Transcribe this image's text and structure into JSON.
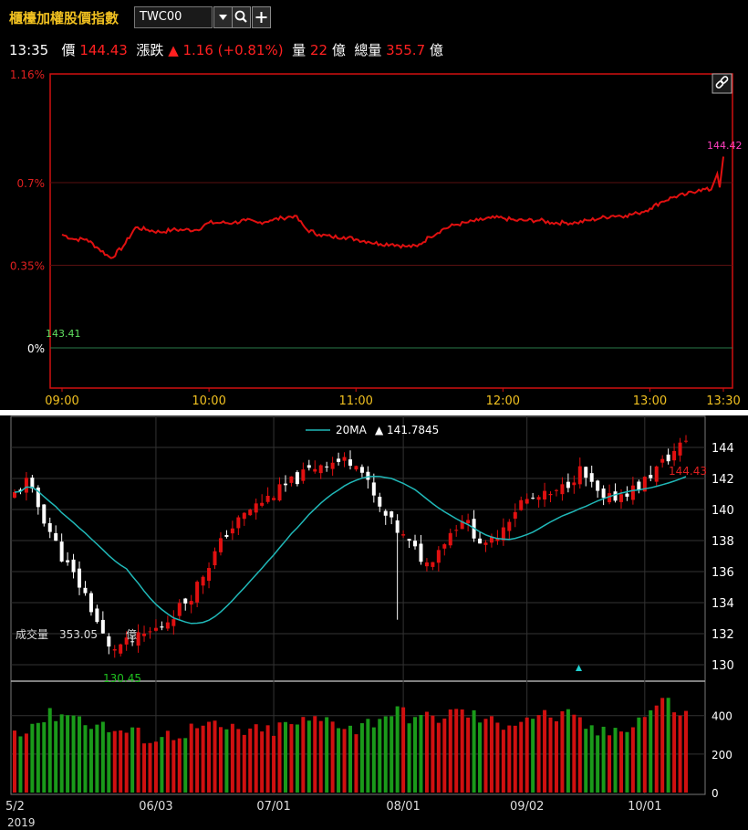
{
  "header": {
    "title": "櫃檯加權股價指數",
    "symbol": "TWC00",
    "time": "13:35",
    "price_label": "價",
    "price": "144.43",
    "change_label": "漲跌",
    "change": "▲ 1.16 (+0.81%)",
    "volume_label": "量",
    "volume": "22",
    "volume_unit": "億",
    "total_volume_label": "總量",
    "total_volume": "355.7",
    "total_volume_unit": "億"
  },
  "icons": {
    "dropdown": "chevron-down-icon",
    "search": "search-icon",
    "add": "plus-icon",
    "link": "link-icon"
  },
  "colors": {
    "up": "#ff2020",
    "down": "#20a020",
    "ma": "#20b8b8",
    "title": "#f0c020"
  },
  "chart_data": [
    {
      "type": "line",
      "title": "",
      "x_ticks": [
        "09:00",
        "10:00",
        "11:00",
        "12:00",
        "13:00",
        "13:30"
      ],
      "y_ticks": [
        "1.16%",
        "0.7%",
        "0.35%",
        "0%"
      ],
      "ylim_percent": [
        -0.17,
        1.16
      ],
      "reference_price": "143.41",
      "last_price_label": "144.42",
      "series": [
        {
          "x": [
            "09:00",
            "09:05",
            "09:10",
            "09:15",
            "09:20",
            "09:25",
            "09:30",
            "09:35",
            "09:40",
            "09:45",
            "09:50",
            "09:55",
            "10:00",
            "10:05",
            "10:10",
            "10:15",
            "10:20",
            "10:25",
            "10:30",
            "10:35",
            "10:40",
            "10:45",
            "10:50",
            "10:55",
            "11:00",
            "11:05",
            "11:10",
            "11:15",
            "11:20",
            "11:25",
            "11:30",
            "11:35",
            "11:40",
            "11:45",
            "11:50",
            "11:55",
            "12:00",
            "12:05",
            "12:10",
            "12:15",
            "12:20",
            "12:25",
            "12:30",
            "12:35",
            "12:40",
            "12:45",
            "12:50",
            "12:55",
            "13:00",
            "13:05",
            "13:10",
            "13:15",
            "13:20",
            "13:25",
            "13:30"
          ],
          "y": [
            0.48,
            0.46,
            0.46,
            0.42,
            0.38,
            0.43,
            0.51,
            0.5,
            0.49,
            0.5,
            0.5,
            0.5,
            0.53,
            0.53,
            0.53,
            0.54,
            0.53,
            0.54,
            0.55,
            0.56,
            0.5,
            0.48,
            0.47,
            0.47,
            0.46,
            0.45,
            0.44,
            0.44,
            0.43,
            0.43,
            0.47,
            0.5,
            0.52,
            0.53,
            0.54,
            0.55,
            0.55,
            0.54,
            0.54,
            0.54,
            0.53,
            0.53,
            0.53,
            0.54,
            0.55,
            0.56,
            0.56,
            0.57,
            0.59,
            0.62,
            0.64,
            0.65,
            0.67,
            0.67,
            0.81
          ]
        }
      ]
    },
    {
      "type": "candlestick",
      "title": "",
      "legend": {
        "name": "20MA",
        "value": "▲ 141.7845"
      },
      "x_ticks": [
        "5/2",
        "06/03",
        "07/01",
        "08/01",
        "09/02",
        "10/01"
      ],
      "year_label": "2019",
      "y_ticks": [
        "144",
        "142",
        "140",
        "138",
        "136",
        "134",
        "132",
        "130"
      ],
      "ylim": [
        129,
        146
      ],
      "last_price_label": "144.43",
      "low_label": "130.45",
      "volume_overlay": {
        "label": "成交量",
        "value": "353.05",
        "unit": "億"
      },
      "volume_y_ticks": [
        "400",
        "200",
        "0"
      ],
      "volume_ylim": [
        0,
        560
      ],
      "candles_count": 115,
      "close_anchors": [
        [
          0,
          141.0
        ],
        [
          2,
          141.8
        ],
        [
          8,
          137.0
        ],
        [
          12,
          134.5
        ],
        [
          16,
          131.0
        ],
        [
          20,
          131.5
        ],
        [
          25,
          132.5
        ],
        [
          30,
          134.5
        ],
        [
          36,
          138.5
        ],
        [
          40,
          140.0
        ],
        [
          46,
          141.5
        ],
        [
          52,
          143.0
        ],
        [
          58,
          143.2
        ],
        [
          62,
          140.0
        ],
        [
          66,
          138.2
        ],
        [
          70,
          136.5
        ],
        [
          76,
          139.5
        ],
        [
          80,
          137.5
        ],
        [
          86,
          140.5
        ],
        [
          92,
          141.0
        ],
        [
          96,
          142.5
        ],
        [
          100,
          140.5
        ],
        [
          106,
          141.5
        ],
        [
          110,
          143.0
        ],
        [
          114,
          144.43
        ]
      ],
      "volume_anchors": [
        [
          0,
          320
        ],
        [
          8,
          420
        ],
        [
          16,
          330
        ],
        [
          24,
          280
        ],
        [
          32,
          340
        ],
        [
          42,
          310
        ],
        [
          48,
          360
        ],
        [
          54,
          380
        ],
        [
          58,
          330
        ],
        [
          64,
          420
        ],
        [
          70,
          380
        ],
        [
          76,
          420
        ],
        [
          82,
          350
        ],
        [
          88,
          400
        ],
        [
          94,
          390
        ],
        [
          100,
          300
        ],
        [
          106,
          380
        ],
        [
          110,
          480
        ],
        [
          114,
          400
        ]
      ]
    }
  ]
}
